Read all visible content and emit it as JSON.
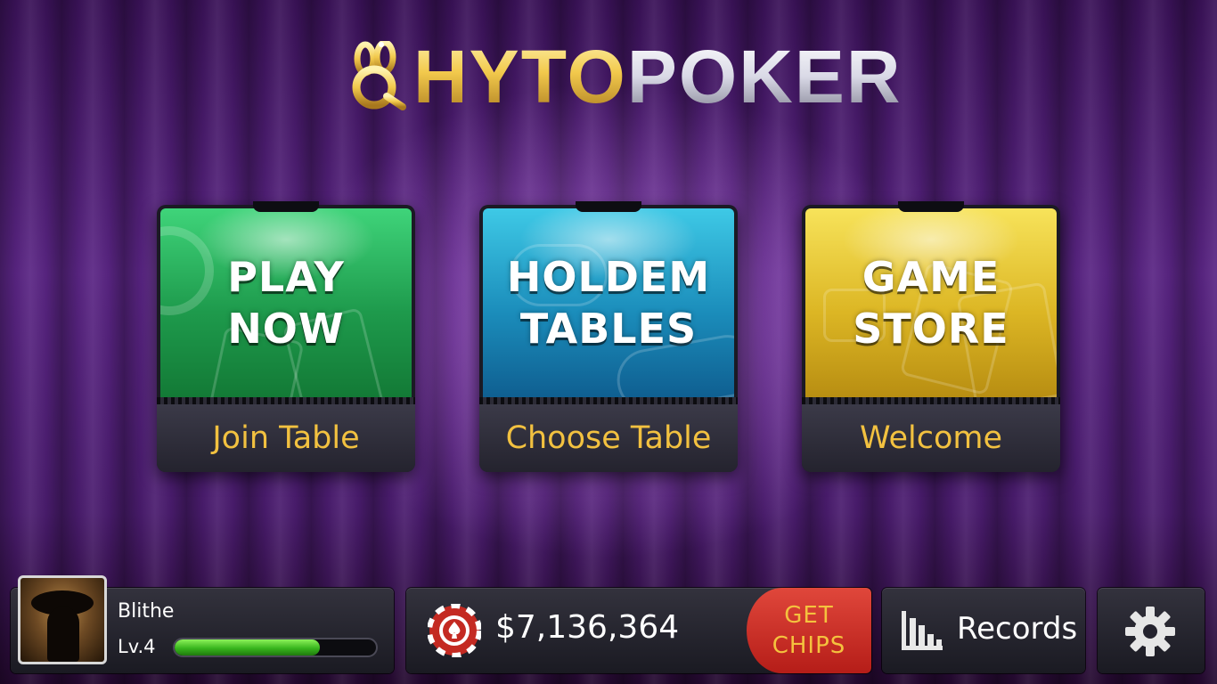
{
  "logo": {
    "part_gold": "HYTO",
    "part_silver": "POKER",
    "icon": "rabbit-logo-icon"
  },
  "cards": [
    {
      "title_line1": "PLAY",
      "title_line2": "NOW",
      "subtitle": "Join Table",
      "color": "#1e9a4c"
    },
    {
      "title_line1": "HOLDEM",
      "title_line2": "TABLES",
      "subtitle": "Choose Table",
      "color": "#1b8dbb"
    },
    {
      "title_line1": "GAME",
      "title_line2": "STORE",
      "subtitle": "Welcome",
      "color": "#dcb624"
    }
  ],
  "profile": {
    "name": "Blithe",
    "level": "Lv.4",
    "xp_progress": 0.72
  },
  "chips": {
    "amount": "$7,136,364",
    "get_chips_line1": "GET",
    "get_chips_line2": "CHIPS",
    "icon": "poker-chip-icon"
  },
  "records": {
    "label": "Records",
    "icon": "bar-chart-icon"
  },
  "settings": {
    "icon": "gear-icon"
  },
  "colors": {
    "accent_gold": "#f2c140",
    "get_chips_red": "#c42a22",
    "background_purple": "#5a2584"
  }
}
